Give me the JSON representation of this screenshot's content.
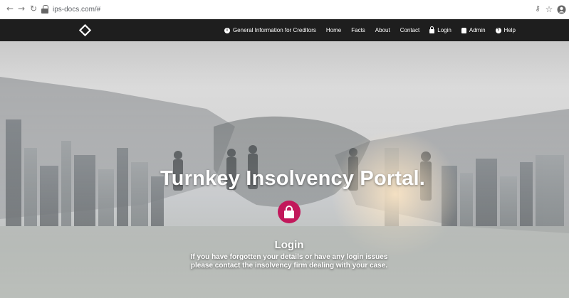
{
  "browser": {
    "url": "ips-docs.com/#",
    "back_icon": "back-arrow-icon",
    "forward_icon": "forward-arrow-icon",
    "reload_icon": "reload-icon",
    "key_icon": "key-icon",
    "star_icon": "star-icon",
    "profile_icon": "profile-icon"
  },
  "header": {
    "logo": "diamond-logo-icon",
    "nav": [
      {
        "label": "General Information for Creditors",
        "icon": "info-icon"
      },
      {
        "label": "Home"
      },
      {
        "label": "Facts"
      },
      {
        "label": "About"
      },
      {
        "label": "Contact"
      },
      {
        "label": "Login",
        "icon": "lock-icon"
      },
      {
        "label": "Admin",
        "icon": "admin-icon"
      },
      {
        "label": "Help",
        "icon": "help-icon"
      }
    ]
  },
  "hero": {
    "title": "Turnkey Insolvency Portal.",
    "login_title": "Login",
    "note_line1": "If you have forgotten your details or have any login issues",
    "note_line2": "please contact the insolvency firm dealing with your case.",
    "accent_color": "#c2185b"
  }
}
